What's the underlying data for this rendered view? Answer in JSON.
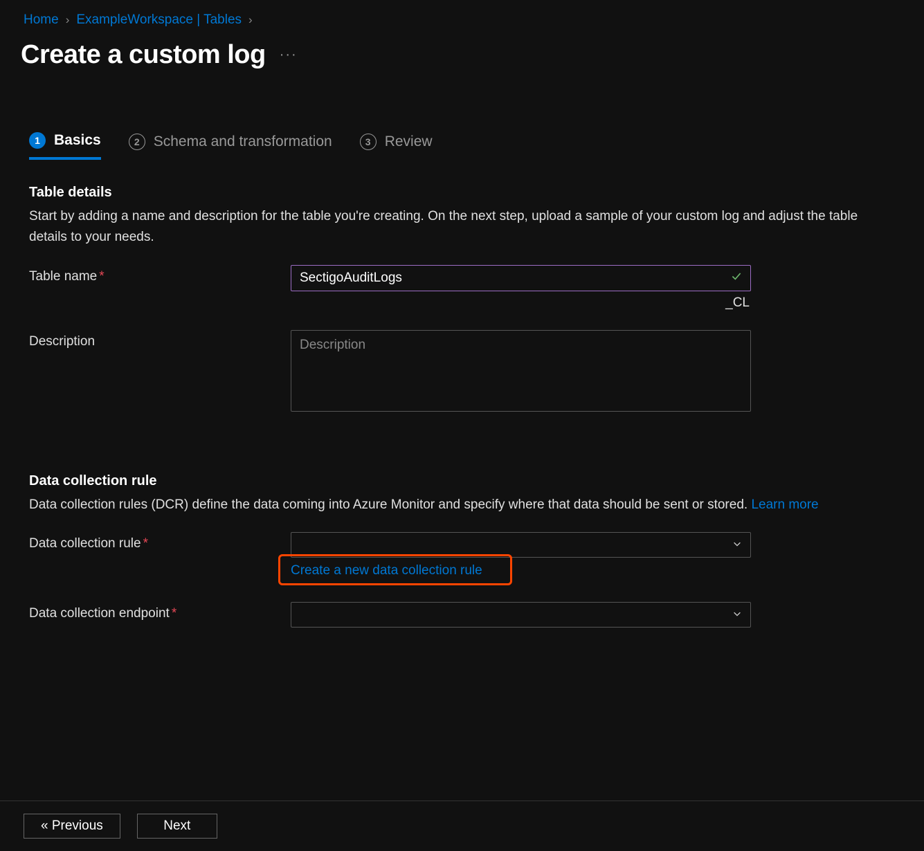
{
  "breadcrumb": {
    "home": "Home",
    "workspace": "ExampleWorkspace | Tables"
  },
  "page": {
    "title": "Create a custom log"
  },
  "tabs": {
    "step1": "Basics",
    "step2": "Schema and transformation",
    "step3": "Review"
  },
  "tableDetails": {
    "title": "Table details",
    "desc": "Start by adding a name and description for the table you're creating. On the next step, upload a sample of your custom log and adjust the table details to your needs.",
    "nameLabel": "Table name",
    "nameValue": "SectigoAuditLogs",
    "suffix": "_CL",
    "descLabel": "Description",
    "descPlaceholder": "Description"
  },
  "dcr": {
    "title": "Data collection rule",
    "desc": "Data collection rules (DCR) define the data coming into Azure Monitor and specify where that data should be sent or stored. ",
    "learnMore": "Learn more",
    "ruleLabel": "Data collection rule",
    "createLink": "Create a new data collection rule",
    "endpointLabel": "Data collection endpoint"
  },
  "footer": {
    "prev": "« Previous",
    "next": "Next"
  }
}
